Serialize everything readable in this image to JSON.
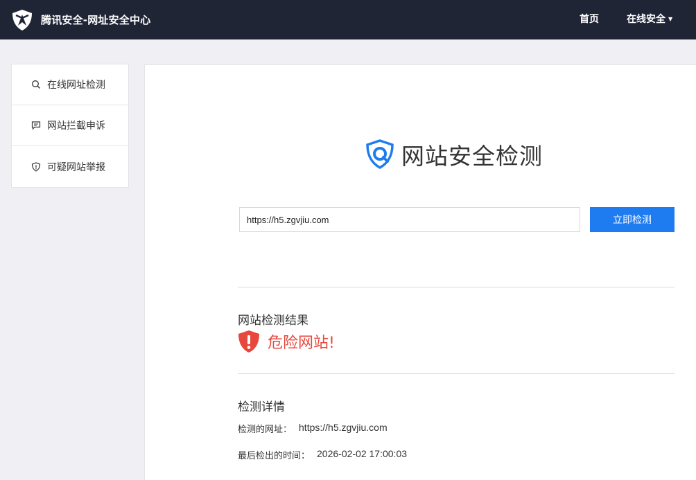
{
  "header": {
    "brand": "腾讯安全-网址安全中心",
    "nav": [
      {
        "label": "首页"
      },
      {
        "label": "在线安全"
      }
    ]
  },
  "sidebar": {
    "items": [
      {
        "label": "在线网址检测",
        "icon": "search-icon"
      },
      {
        "label": "网站拦截申诉",
        "icon": "message-icon"
      },
      {
        "label": "可疑网站举报",
        "icon": "shield-alert-icon"
      }
    ]
  },
  "main": {
    "title": "网站安全检测",
    "url_value": "https://h5.zgvjiu.com",
    "check_button": "立即检测",
    "result_title": "网站检测结果",
    "result_status": "危险网站!",
    "details_title": "检测详情",
    "details": [
      {
        "label": "检测的网址：",
        "value": "https://h5.zgvjiu.com"
      },
      {
        "label": "最后检出的时间：",
        "value": "2026-02-02 17:00:03"
      }
    ]
  },
  "colors": {
    "header_bg": "#202536",
    "accent": "#1f7cf0",
    "danger": "#e8473e"
  }
}
